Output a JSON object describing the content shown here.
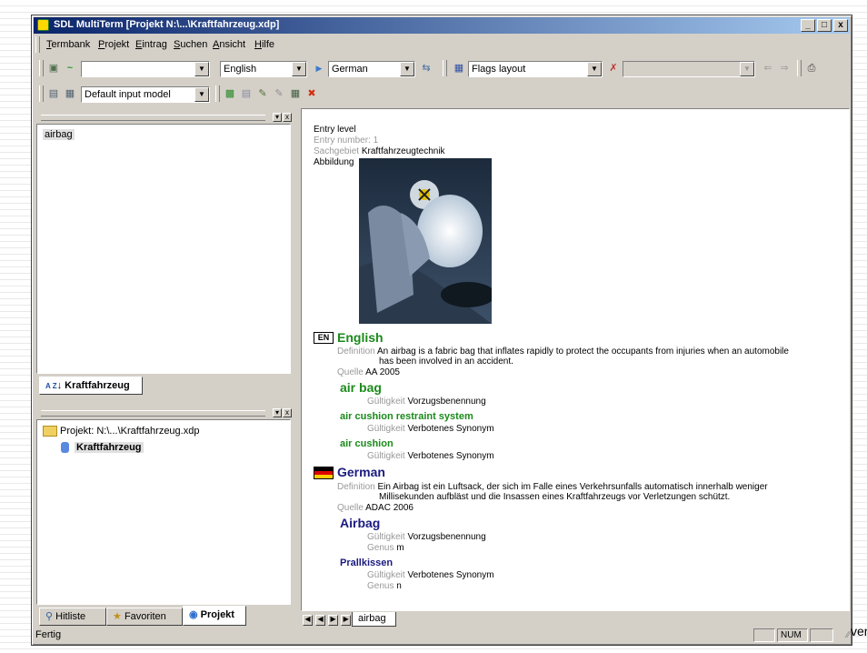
{
  "window": {
    "title": "SDL MultiTerm [Projekt N:\\...\\Kraftfahrzeug.xdp]",
    "min": "_",
    "max": "□",
    "close": "x"
  },
  "menu": [
    "Termbank",
    "Projekt",
    "Eintrag",
    "Suchen",
    "Ansicht",
    "Hilfe"
  ],
  "toolbar1": {
    "search_value": "",
    "source_lang": "English",
    "target_lang": "German",
    "layout": "Flags layout",
    "filter": ""
  },
  "toolbar2": {
    "input_model": "Default input model"
  },
  "hitlist": {
    "items": [
      "airbag"
    ],
    "tab_label": "Kraftfahrzeug",
    "sort_icon_text": "A Z"
  },
  "project_tree": {
    "root": "Projekt: N:\\...\\Kraftfahrzeug.xdp",
    "child": "Kraftfahrzeug"
  },
  "bottom_tabs": [
    "Hitliste",
    "Favoriten",
    "Projekt"
  ],
  "entry": {
    "level_label": "Entry level",
    "number_label": "Entry number:",
    "number": "1",
    "sachgebiet_label": "Sachgebiet",
    "sachgebiet": "Kraftfahrzeugtechnik",
    "abbildung_label": "Abbildung",
    "english": {
      "badge": "EN",
      "name": "English",
      "definition_label": "Definition",
      "definition_1": "An airbag is a fabric bag that inflates rapidly to protect the occupants from injuries when an automobile",
      "definition_2": "has been involved in an accident.",
      "quelle_label": "Quelle",
      "quelle": "AA 2005",
      "terms": [
        {
          "term": "air bag",
          "label": "Gültigkeit",
          "value": "Vorzugsbenennung"
        },
        {
          "term": "air cushion restraint system",
          "label": "Gültigkeit",
          "value": "Verbotenes Synonym"
        },
        {
          "term": "air cushion",
          "label": "Gültigkeit",
          "value": "Verbotenes Synonym"
        }
      ]
    },
    "german": {
      "name": "German",
      "definition_label": "Definition",
      "definition_1": "Ein Airbag ist ein Luftsack, der sich im Falle eines Verkehrsunfalls automatisch innerhalb weniger",
      "definition_2": "Millisekunden aufbläst und die Insassen eines Kraftfahrzeugs vor Verletzungen schützt.",
      "quelle_label": "Quelle",
      "quelle": "ADAC 2006",
      "terms": [
        {
          "term": "Airbag",
          "label": "Gültigkeit",
          "value": "Vorzugsbenennung",
          "genus_label": "Genus",
          "genus": "m"
        },
        {
          "term": "Prallkissen",
          "label": "Gültigkeit",
          "value": "Verbotenes Synonym",
          "genus_label": "Genus",
          "genus": "n"
        }
      ]
    }
  },
  "entry_tab": "airbag",
  "status": {
    "text": "Fertig",
    "num": "NUM",
    "outside": "ver"
  },
  "colors": {
    "english_green": "#1a8a1a",
    "german_navy": "#1a1a80",
    "titlebar": "#0a246a"
  }
}
